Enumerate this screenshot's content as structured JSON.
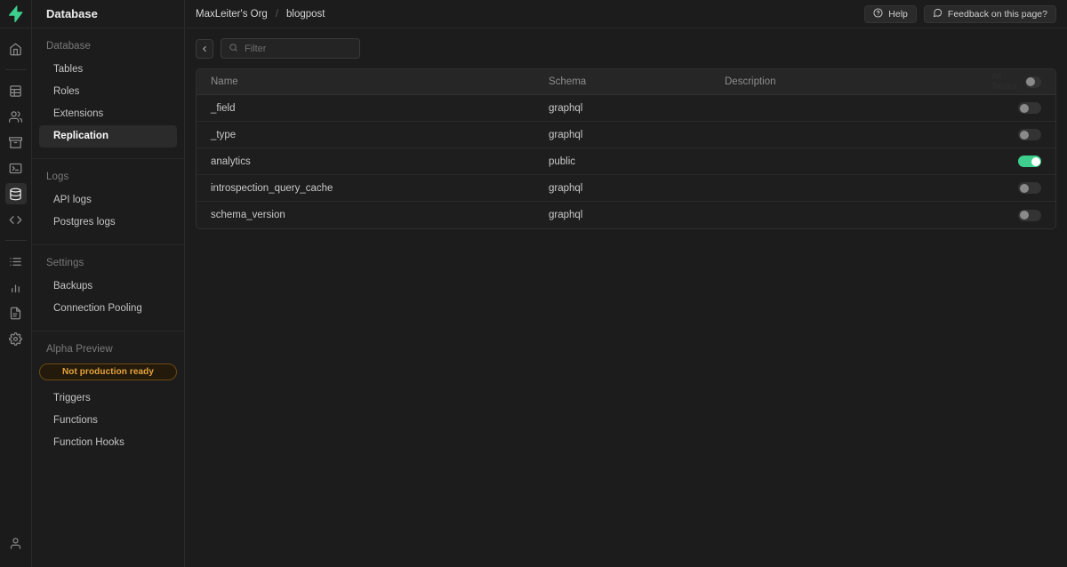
{
  "rail": {
    "logo_icon": "supabase-bolt-logo",
    "items": [
      {
        "icon": "home-icon",
        "name": "rail-home",
        "active": false
      },
      {
        "icon": "table-editor-icon",
        "name": "rail-table-editor",
        "active": false
      },
      {
        "icon": "authentication-icon",
        "name": "rail-authentication",
        "active": false
      },
      {
        "icon": "storage-icon",
        "name": "rail-storage",
        "active": false
      },
      {
        "icon": "sql-editor-icon",
        "name": "rail-sql-editor",
        "active": false
      },
      {
        "icon": "database-icon",
        "name": "rail-database",
        "active": true
      },
      {
        "icon": "api-code-icon",
        "name": "rail-api",
        "active": false
      },
      {
        "icon": "list-icon",
        "name": "rail-logs",
        "active": false
      },
      {
        "icon": "chart-bar-icon",
        "name": "rail-reports",
        "active": false
      },
      {
        "icon": "document-icon",
        "name": "rail-docs",
        "active": false
      },
      {
        "icon": "gear-icon",
        "name": "rail-settings",
        "active": false
      }
    ],
    "account_icon": "user-account-icon"
  },
  "sidebar": {
    "title": "Database",
    "sections": [
      {
        "label": "Database",
        "items": [
          {
            "label": "Tables",
            "active": false
          },
          {
            "label": "Roles",
            "active": false
          },
          {
            "label": "Extensions",
            "active": false
          },
          {
            "label": "Replication",
            "active": true
          }
        ]
      },
      {
        "label": "Logs",
        "items": [
          {
            "label": "API logs",
            "active": false
          },
          {
            "label": "Postgres logs",
            "active": false
          }
        ]
      },
      {
        "label": "Settings",
        "items": [
          {
            "label": "Backups",
            "active": false
          },
          {
            "label": "Connection Pooling",
            "active": false
          }
        ]
      },
      {
        "label": "Alpha Preview",
        "badge": "Not production ready",
        "items": [
          {
            "label": "Triggers",
            "active": false
          },
          {
            "label": "Functions",
            "active": false
          },
          {
            "label": "Function Hooks",
            "active": false
          }
        ]
      }
    ]
  },
  "topbar": {
    "breadcrumbs": [
      "MaxLeiter's Org",
      "blogpost"
    ],
    "separator": "/",
    "help_label": "Help",
    "help_icon": "question-circle-icon",
    "feedback_label": "Feedback on this page?",
    "feedback_icon": "chat-bubble-icon"
  },
  "toolbar": {
    "collapse_icon": "chevron-left-icon",
    "search_icon": "search-icon",
    "filter_placeholder": "Filter",
    "filter_value": ""
  },
  "table": {
    "columns": [
      "Name",
      "Schema",
      "Description"
    ],
    "all_tables_label": "All Tables",
    "all_tables_enabled": false,
    "rows": [
      {
        "name": "_field",
        "schema": "graphql",
        "description": "",
        "enabled": false
      },
      {
        "name": "_type",
        "schema": "graphql",
        "description": "",
        "enabled": false
      },
      {
        "name": "analytics",
        "schema": "public",
        "description": "",
        "enabled": true
      },
      {
        "name": "introspection_query_cache",
        "schema": "graphql",
        "description": "",
        "enabled": false
      },
      {
        "name": "schema_version",
        "schema": "graphql",
        "description": "",
        "enabled": false
      }
    ]
  },
  "colors": {
    "accent_green": "#3ECF8E",
    "badge_amber": "#E5A33A",
    "background": "#1C1C1C"
  }
}
